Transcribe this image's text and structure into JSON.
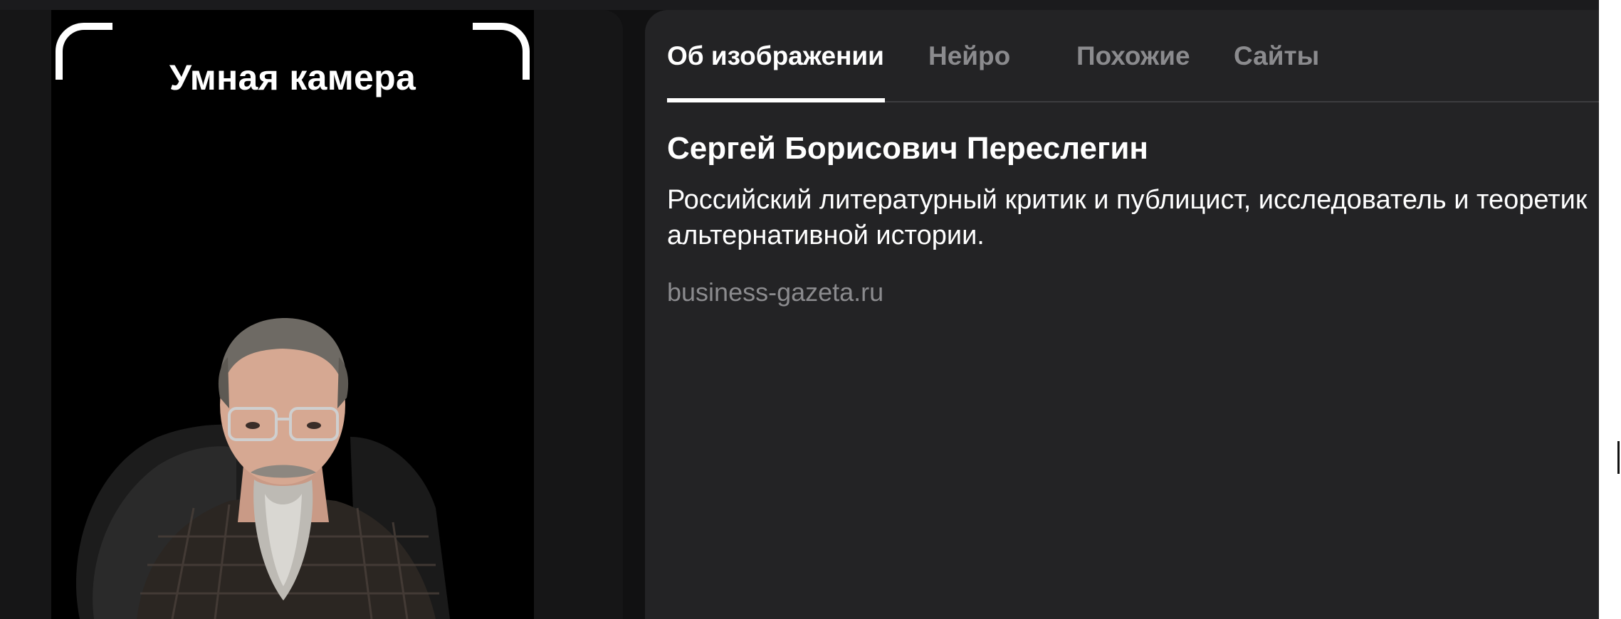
{
  "camera": {
    "title": "Умная камера"
  },
  "tabs": [
    {
      "label": "Об изображении",
      "active": true
    },
    {
      "label": "Нейро",
      "active": false
    },
    {
      "label": "Похожие",
      "active": false
    },
    {
      "label": "Сайты",
      "active": false
    }
  ],
  "result": {
    "name": "Сергей Борисович Переслегин",
    "description": "Российский литературный критик и публицист, исследователь и теоретик альтернативной истории.",
    "source": "business-gazeta.ru"
  },
  "colors": {
    "background": "#111112",
    "panel": "#232325",
    "accent": "#ffffff",
    "muted": "#8b8b8e"
  }
}
